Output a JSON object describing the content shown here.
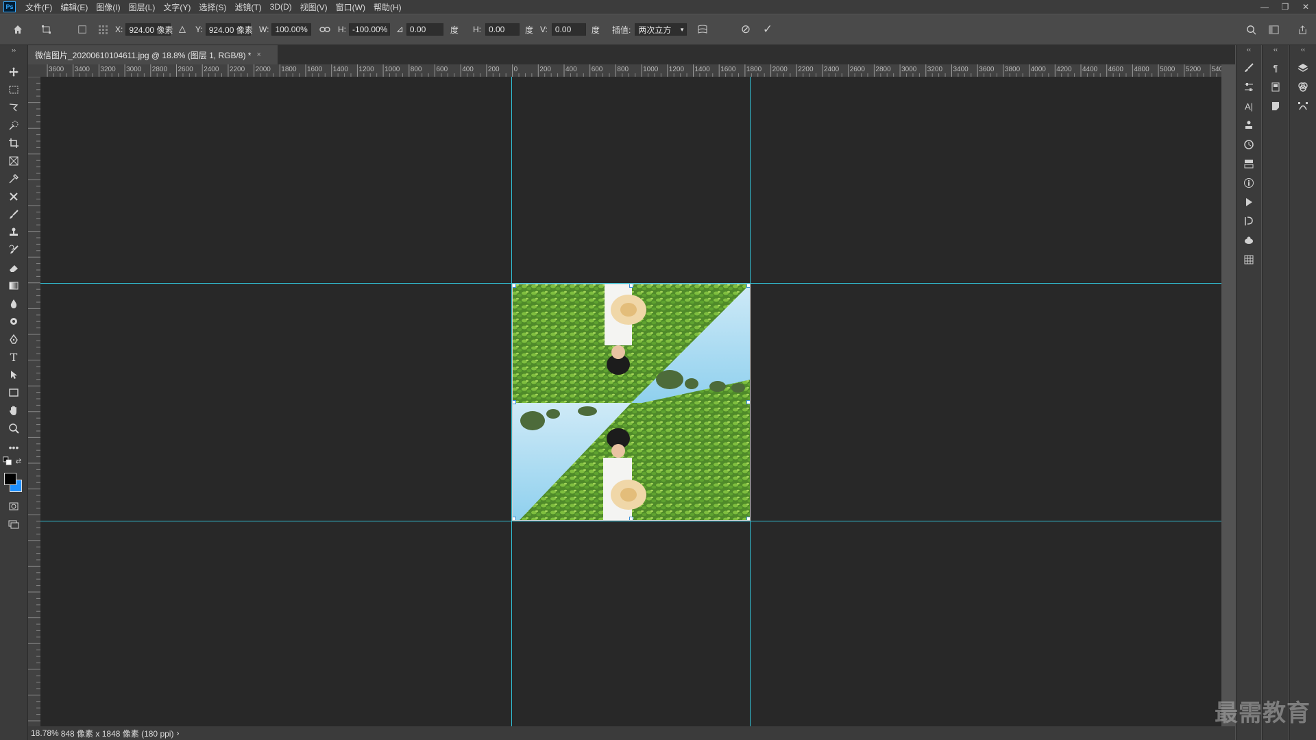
{
  "app": {
    "logo": "Ps"
  },
  "menu": [
    "文件(F)",
    "编辑(E)",
    "图像(I)",
    "图层(L)",
    "文字(Y)",
    "选择(S)",
    "滤镜(T)",
    "3D(D)",
    "视图(V)",
    "窗口(W)",
    "帮助(H)"
  ],
  "window_controls": {
    "minimize": "—",
    "restore": "❐",
    "close": "✕"
  },
  "options": {
    "x_label": "X:",
    "x_value": "924.00 像素",
    "y_label": "Y:",
    "y_value": "924.00 像素",
    "w_label": "W:",
    "w_value": "100.00%",
    "h_label": "H:",
    "h_value": "-100.00%",
    "angle_value": "0.00",
    "angle_unit": "度",
    "skew_h_label": "H:",
    "skew_h_value": "0.00",
    "skew_h_unit": "度",
    "skew_v_label": "V:",
    "skew_v_value": "0.00",
    "skew_v_unit": "度",
    "interp_label": "插值:",
    "interp_value": "两次立方",
    "cancel_symbol": "⊘",
    "commit_symbol": "✓"
  },
  "document": {
    "tab_title": "微信图片_20200610104611.jpg @ 18.8% (图层 1, RGB/8) *",
    "tab_close": "×"
  },
  "ruler": {
    "top_labels": [
      "3600",
      "3400",
      "3200",
      "3000",
      "2800",
      "2600",
      "2400",
      "2200",
      "2000",
      "1800",
      "1600",
      "1400",
      "1200",
      "1000",
      "800",
      "600",
      "400",
      "200",
      "0",
      "200",
      "400",
      "600",
      "800",
      "1000",
      "1200",
      "1400",
      "1600",
      "1800",
      "2000",
      "2200",
      "2400",
      "2600",
      "2800",
      "3000",
      "3200",
      "3400",
      "3600",
      "3800",
      "4000",
      "4200",
      "4400",
      "4600",
      "4800",
      "5000",
      "5200",
      "540"
    ]
  },
  "status": {
    "zoom": "18.78%",
    "info": "848 像素 x 1848 像素 (180 ppi)",
    "arrow": "›"
  },
  "watermark": "最需教育",
  "colors": {
    "guide": "#31c3d8",
    "foreground": "#000000",
    "background": "#1e90ff"
  }
}
